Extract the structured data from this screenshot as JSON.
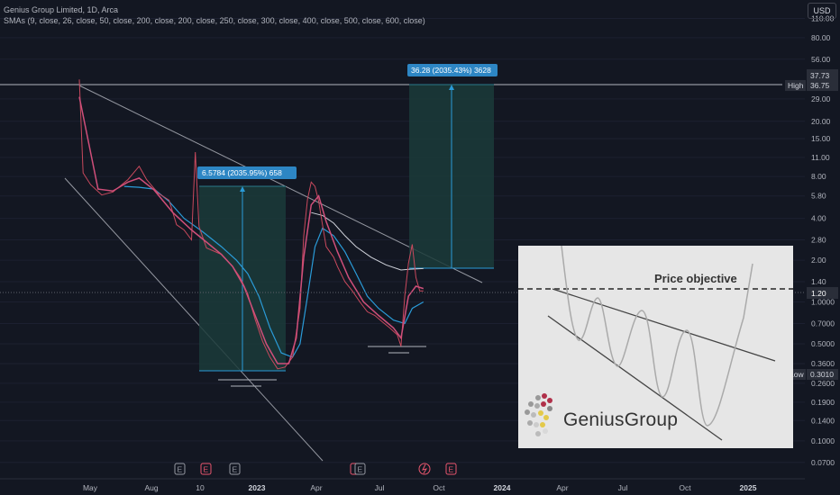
{
  "header": {
    "symbol_line": "Genius Group Limited, 1D, Arca",
    "sma_line": "SMAs (9, close, 26, close, 50, close, 200, close, 200, close, 250, close, 300, close, 400, close, 500, close, 600, close)",
    "currency": "USD"
  },
  "chart_data": {
    "type": "line",
    "y_scale": "log",
    "y_ticks": [
      "110.00",
      "80.00",
      "56.00",
      "37.73",
      "29.00",
      "20.00",
      "15.00",
      "11.00",
      "8.00",
      "5.80",
      "4.00",
      "2.80",
      "2.00",
      "1.40",
      "1.20",
      "1.0000",
      "0.7000",
      "0.5000",
      "0.3600",
      "0.3010",
      "0.2600",
      "0.1900",
      "0.1400",
      "0.1000",
      "0.0700"
    ],
    "x_ticks": [
      "May",
      "Aug",
      "10",
      "2023",
      "Apr",
      "Jul",
      "Oct",
      "2024",
      "Apr",
      "Jul",
      "Oct",
      "2025"
    ],
    "price_labels": {
      "high_label": "High",
      "high_value": "36.75",
      "top_value": "37.73",
      "last_value": "1.20",
      "low_label": "Low",
      "low_value": "0.3010"
    },
    "annotations": [
      {
        "text": "6.5784 (2035.95%) 658"
      },
      {
        "text": "36.28 (2035.43%) 3628"
      }
    ],
    "event_markers": [
      "E",
      "E",
      "E",
      "E",
      "E",
      "E"
    ],
    "price_series": [
      {
        "x": 0,
        "y": 40
      },
      {
        "x": 1,
        "y": 8.5
      },
      {
        "x": 3,
        "y": 7
      },
      {
        "x": 6,
        "y": 5.9
      },
      {
        "x": 9,
        "y": 6.2
      },
      {
        "x": 13,
        "y": 7.6
      },
      {
        "x": 16,
        "y": 9.5
      },
      {
        "x": 18,
        "y": 7.6
      },
      {
        "x": 21,
        "y": 6.1
      },
      {
        "x": 24,
        "y": 5.4
      },
      {
        "x": 26,
        "y": 3.6
      },
      {
        "x": 28,
        "y": 3.3
      },
      {
        "x": 30,
        "y": 2.8
      },
      {
        "x": 31,
        "y": 12
      },
      {
        "x": 32,
        "y": 3.5
      },
      {
        "x": 34,
        "y": 2.45
      },
      {
        "x": 38,
        "y": 2.2
      },
      {
        "x": 41,
        "y": 1.8
      },
      {
        "x": 43,
        "y": 1.5
      },
      {
        "x": 45,
        "y": 1.15
      },
      {
        "x": 47,
        "y": 0.75
      },
      {
        "x": 49,
        "y": 0.52
      },
      {
        "x": 51,
        "y": 0.4
      },
      {
        "x": 53,
        "y": 0.33
      },
      {
        "x": 55,
        "y": 0.34
      },
      {
        "x": 57,
        "y": 0.4
      },
      {
        "x": 59,
        "y": 0.9
      },
      {
        "x": 60,
        "y": 3
      },
      {
        "x": 61,
        "y": 5.5
      },
      {
        "x": 62,
        "y": 7.3
      },
      {
        "x": 63,
        "y": 6.8
      },
      {
        "x": 64,
        "y": 5.3
      },
      {
        "x": 65,
        "y": 3.6
      },
      {
        "x": 66,
        "y": 2.5
      },
      {
        "x": 68,
        "y": 2.1
      },
      {
        "x": 69,
        "y": 1.8
      },
      {
        "x": 71,
        "y": 1.4
      },
      {
        "x": 73,
        "y": 1.2
      },
      {
        "x": 75,
        "y": 1.0
      },
      {
        "x": 77,
        "y": 0.85
      },
      {
        "x": 79,
        "y": 0.8
      },
      {
        "x": 81,
        "y": 0.72
      },
      {
        "x": 83,
        "y": 0.65
      },
      {
        "x": 85,
        "y": 0.58
      },
      {
        "x": 86,
        "y": 0.48
      },
      {
        "x": 87,
        "y": 1.1
      },
      {
        "x": 88,
        "y": 1.9
      },
      {
        "x": 89,
        "y": 2.6
      },
      {
        "x": 90,
        "y": 1.5
      },
      {
        "x": 91,
        "y": 1.2
      },
      {
        "x": 92,
        "y": 1.2
      }
    ],
    "sma_fast": [
      {
        "x": 0,
        "y": 30
      },
      {
        "x": 5,
        "y": 6.5
      },
      {
        "x": 9,
        "y": 6.3
      },
      {
        "x": 13,
        "y": 7.3
      },
      {
        "x": 16,
        "y": 7.8
      },
      {
        "x": 20,
        "y": 6.4
      },
      {
        "x": 25,
        "y": 4.4
      },
      {
        "x": 30,
        "y": 3.3
      },
      {
        "x": 34,
        "y": 2.7
      },
      {
        "x": 38,
        "y": 2.2
      },
      {
        "x": 41,
        "y": 1.8
      },
      {
        "x": 44,
        "y": 1.3
      },
      {
        "x": 47,
        "y": 0.8
      },
      {
        "x": 50,
        "y": 0.5
      },
      {
        "x": 53,
        "y": 0.36
      },
      {
        "x": 56,
        "y": 0.36
      },
      {
        "x": 58,
        "y": 0.55
      },
      {
        "x": 60,
        "y": 2.1
      },
      {
        "x": 62,
        "y": 5.0
      },
      {
        "x": 64,
        "y": 5.8
      },
      {
        "x": 66,
        "y": 3.8
      },
      {
        "x": 69,
        "y": 2.3
      },
      {
        "x": 72,
        "y": 1.5
      },
      {
        "x": 76,
        "y": 1.0
      },
      {
        "x": 80,
        "y": 0.8
      },
      {
        "x": 84,
        "y": 0.65
      },
      {
        "x": 86,
        "y": 0.55
      },
      {
        "x": 88,
        "y": 1.1
      },
      {
        "x": 90,
        "y": 1.3
      },
      {
        "x": 92,
        "y": 1.25
      }
    ],
    "sma_mid": [
      {
        "x": 12,
        "y": 6.8
      },
      {
        "x": 16,
        "y": 6.7
      },
      {
        "x": 20,
        "y": 6.5
      },
      {
        "x": 24,
        "y": 5.3
      },
      {
        "x": 28,
        "y": 4.0
      },
      {
        "x": 33,
        "y": 3.2
      },
      {
        "x": 38,
        "y": 2.5
      },
      {
        "x": 42,
        "y": 2.0
      },
      {
        "x": 45,
        "y": 1.6
      },
      {
        "x": 48,
        "y": 1.1
      },
      {
        "x": 51,
        "y": 0.65
      },
      {
        "x": 54,
        "y": 0.43
      },
      {
        "x": 57,
        "y": 0.4
      },
      {
        "x": 59,
        "y": 0.5
      },
      {
        "x": 61,
        "y": 1.1
      },
      {
        "x": 63,
        "y": 2.5
      },
      {
        "x": 65,
        "y": 3.4
      },
      {
        "x": 68,
        "y": 3.0
      },
      {
        "x": 71,
        "y": 2.3
      },
      {
        "x": 74,
        "y": 1.6
      },
      {
        "x": 77,
        "y": 1.1
      },
      {
        "x": 80,
        "y": 0.9
      },
      {
        "x": 84,
        "y": 0.74
      },
      {
        "x": 87,
        "y": 0.7
      },
      {
        "x": 89,
        "y": 0.9
      },
      {
        "x": 92,
        "y": 1.0
      }
    ],
    "sma_slow": [
      {
        "x": 62,
        "y": 4.4
      },
      {
        "x": 65,
        "y": 4.2
      },
      {
        "x": 68,
        "y": 3.7
      },
      {
        "x": 71,
        "y": 3.0
      },
      {
        "x": 74,
        "y": 2.5
      },
      {
        "x": 78,
        "y": 2.1
      },
      {
        "x": 82,
        "y": 1.85
      },
      {
        "x": 86,
        "y": 1.7
      },
      {
        "x": 88,
        "y": 1.72
      },
      {
        "x": 92,
        "y": 1.74
      }
    ]
  },
  "inset": {
    "title": "Price objective",
    "brand": "GeniusGroup"
  }
}
